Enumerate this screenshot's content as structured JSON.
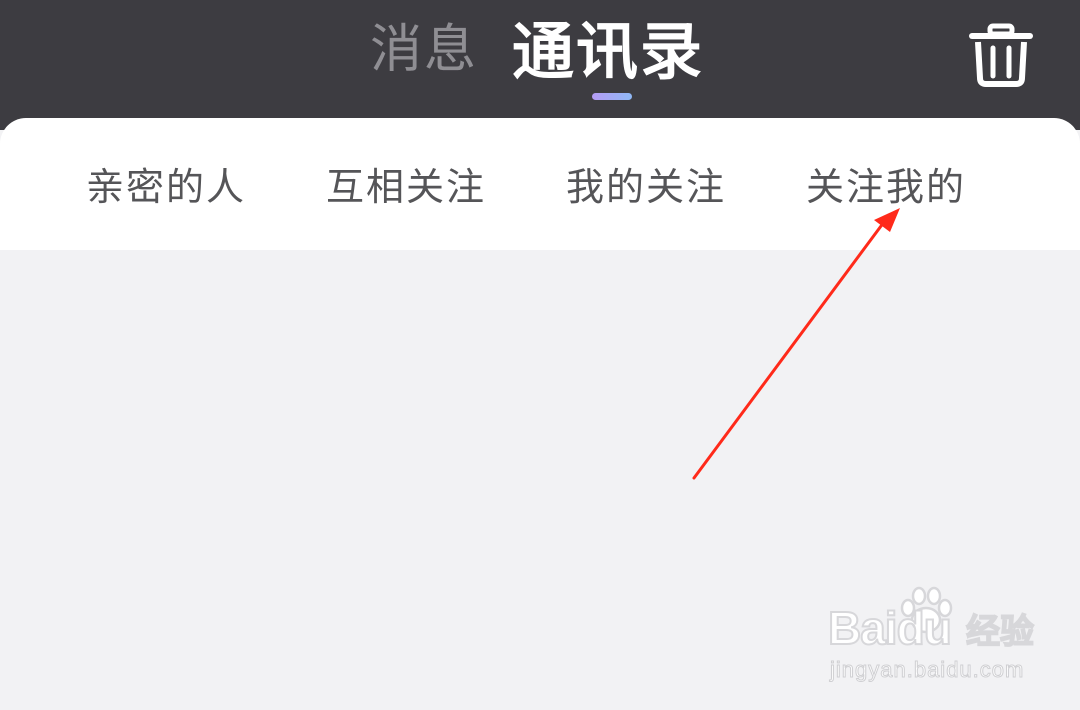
{
  "header": {
    "tabs": [
      {
        "label": "消息",
        "active": false
      },
      {
        "label": "通讯录",
        "active": true
      }
    ],
    "trash_icon": "trash-icon"
  },
  "subtabs": [
    {
      "label": "亲密的人"
    },
    {
      "label": "互相关注"
    },
    {
      "label": "我的关注"
    },
    {
      "label": "关注我的"
    }
  ],
  "annotation": {
    "arrow_color": "#ff2a1a",
    "points_to": "关注我的"
  },
  "watermark": {
    "brand": "Bai",
    "brand_suffix": "du",
    "product": "经验",
    "url": "jingyan.baidu.com"
  },
  "colors": {
    "header_bg": "#3d3c41",
    "active_tab": "#ffffff",
    "inactive_tab": "#8f8e93",
    "indicator_start": "#b59cf5",
    "indicator_end": "#8fb8f5",
    "subtab_text": "#555558",
    "content_bg": "#f2f2f4"
  }
}
